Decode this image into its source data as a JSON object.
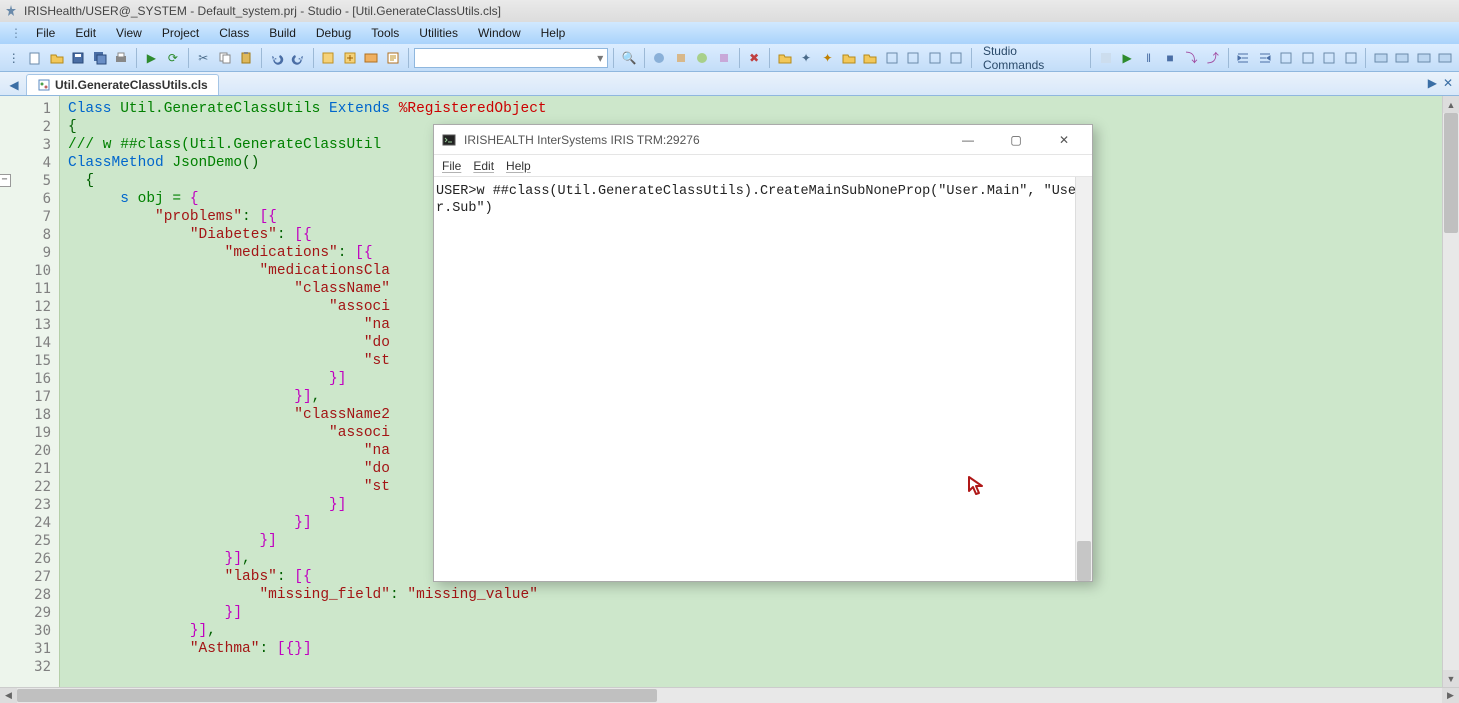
{
  "title": "IRISHealth/USER@_SYSTEM - Default_system.prj - Studio - [Util.GenerateClassUtils.cls]",
  "menu": [
    "File",
    "Edit",
    "View",
    "Project",
    "Class",
    "Build",
    "Debug",
    "Tools",
    "Utilities",
    "Window",
    "Help"
  ],
  "studioCommands": "Studio Commands",
  "tab": {
    "label": "Util.GenerateClassUtils.cls"
  },
  "gutter": {
    "start": 1,
    "end": 32,
    "foldAt": 5
  },
  "code": {
    "lines": [
      {
        "segs": [
          {
            "t": "Class ",
            "c": "kw"
          },
          {
            "t": "Util.GenerateClassUtils",
            "c": "cls"
          },
          {
            "t": " Extends ",
            "c": "kw"
          },
          {
            "t": "%RegisteredObject",
            "c": "pct"
          }
        ]
      },
      {
        "segs": [
          {
            "t": "{",
            "c": "punc"
          }
        ]
      },
      {
        "segs": [
          {
            "t": "",
            "c": ""
          }
        ]
      },
      {
        "segs": [
          {
            "t": "/// w ##class(Util.GenerateClassUtil",
            "c": "cmt"
          }
        ]
      },
      {
        "segs": [
          {
            "t": "ClassMethod ",
            "c": "kw"
          },
          {
            "t": "JsonDemo",
            "c": "cls"
          },
          {
            "t": "()",
            "c": "punc"
          }
        ]
      },
      {
        "segs": [
          {
            "t": "  {",
            "c": "punc"
          }
        ]
      },
      {
        "segs": [
          {
            "t": "      ",
            "c": ""
          },
          {
            "t": "s",
            "c": "kw"
          },
          {
            "t": " obj = ",
            "c": "cls"
          },
          {
            "t": "{",
            "c": "brk"
          }
        ]
      },
      {
        "segs": [
          {
            "t": "          ",
            "c": ""
          },
          {
            "t": "\"problems\"",
            "c": "str"
          },
          {
            "t": ": ",
            "c": "punc"
          },
          {
            "t": "[{",
            "c": "brk"
          }
        ]
      },
      {
        "segs": [
          {
            "t": "              ",
            "c": ""
          },
          {
            "t": "\"Diabetes\"",
            "c": "str"
          },
          {
            "t": ": ",
            "c": "punc"
          },
          {
            "t": "[{",
            "c": "brk"
          }
        ]
      },
      {
        "segs": [
          {
            "t": "                  ",
            "c": ""
          },
          {
            "t": "\"medications\"",
            "c": "str"
          },
          {
            "t": ": ",
            "c": "punc"
          },
          {
            "t": "[{",
            "c": "brk"
          }
        ]
      },
      {
        "segs": [
          {
            "t": "                      ",
            "c": ""
          },
          {
            "t": "\"medicationsCla",
            "c": "str"
          }
        ]
      },
      {
        "segs": [
          {
            "t": "                          ",
            "c": ""
          },
          {
            "t": "\"className\"",
            "c": "str"
          }
        ]
      },
      {
        "segs": [
          {
            "t": "                              ",
            "c": ""
          },
          {
            "t": "\"associ",
            "c": "str"
          }
        ]
      },
      {
        "segs": [
          {
            "t": "                                  ",
            "c": ""
          },
          {
            "t": "\"na",
            "c": "str"
          }
        ]
      },
      {
        "segs": [
          {
            "t": "                                  ",
            "c": ""
          },
          {
            "t": "\"do",
            "c": "str"
          }
        ]
      },
      {
        "segs": [
          {
            "t": "                                  ",
            "c": ""
          },
          {
            "t": "\"st",
            "c": "str"
          }
        ]
      },
      {
        "segs": [
          {
            "t": "                              ",
            "c": ""
          },
          {
            "t": "}]",
            "c": "brk"
          }
        ]
      },
      {
        "segs": [
          {
            "t": "                          ",
            "c": ""
          },
          {
            "t": "}]",
            "c": "brk"
          },
          {
            "t": ",",
            "c": "punc"
          }
        ]
      },
      {
        "segs": [
          {
            "t": "                          ",
            "c": ""
          },
          {
            "t": "\"className2",
            "c": "str"
          }
        ]
      },
      {
        "segs": [
          {
            "t": "                              ",
            "c": ""
          },
          {
            "t": "\"associ",
            "c": "str"
          }
        ]
      },
      {
        "segs": [
          {
            "t": "                                  ",
            "c": ""
          },
          {
            "t": "\"na",
            "c": "str"
          }
        ]
      },
      {
        "segs": [
          {
            "t": "                                  ",
            "c": ""
          },
          {
            "t": "\"do",
            "c": "str"
          }
        ]
      },
      {
        "segs": [
          {
            "t": "                                  ",
            "c": ""
          },
          {
            "t": "\"st",
            "c": "str"
          }
        ]
      },
      {
        "segs": [
          {
            "t": "                              ",
            "c": ""
          },
          {
            "t": "}]",
            "c": "brk"
          }
        ]
      },
      {
        "segs": [
          {
            "t": "                          ",
            "c": ""
          },
          {
            "t": "}]",
            "c": "brk"
          }
        ]
      },
      {
        "segs": [
          {
            "t": "                      ",
            "c": ""
          },
          {
            "t": "}]",
            "c": "brk"
          }
        ]
      },
      {
        "segs": [
          {
            "t": "                  ",
            "c": ""
          },
          {
            "t": "}]",
            "c": "brk"
          },
          {
            "t": ",",
            "c": "punc"
          }
        ]
      },
      {
        "segs": [
          {
            "t": "                  ",
            "c": ""
          },
          {
            "t": "\"labs\"",
            "c": "str"
          },
          {
            "t": ": ",
            "c": "punc"
          },
          {
            "t": "[{",
            "c": "brk"
          }
        ]
      },
      {
        "segs": [
          {
            "t": "                      ",
            "c": ""
          },
          {
            "t": "\"missing_field\"",
            "c": "str"
          },
          {
            "t": ": ",
            "c": "punc"
          },
          {
            "t": "\"missing_value\"",
            "c": "str"
          }
        ]
      },
      {
        "segs": [
          {
            "t": "                  ",
            "c": ""
          },
          {
            "t": "}]",
            "c": "brk"
          }
        ]
      },
      {
        "segs": [
          {
            "t": "              ",
            "c": ""
          },
          {
            "t": "}]",
            "c": "brk"
          },
          {
            "t": ",",
            "c": "punc"
          }
        ]
      },
      {
        "segs": [
          {
            "t": "              ",
            "c": ""
          },
          {
            "t": "\"Asthma\"",
            "c": "str"
          },
          {
            "t": ": ",
            "c": "punc"
          },
          {
            "t": "[{}]",
            "c": "brk"
          }
        ]
      }
    ]
  },
  "popup": {
    "title": "IRISHEALTH InterSystems IRIS TRM:29276",
    "menu": [
      "File",
      "Edit",
      "Help"
    ],
    "body": "USER>w ##class(Util.GenerateClassUtils).CreateMainSubNoneProp(\"User.Main\", \"User.Sub\")"
  }
}
